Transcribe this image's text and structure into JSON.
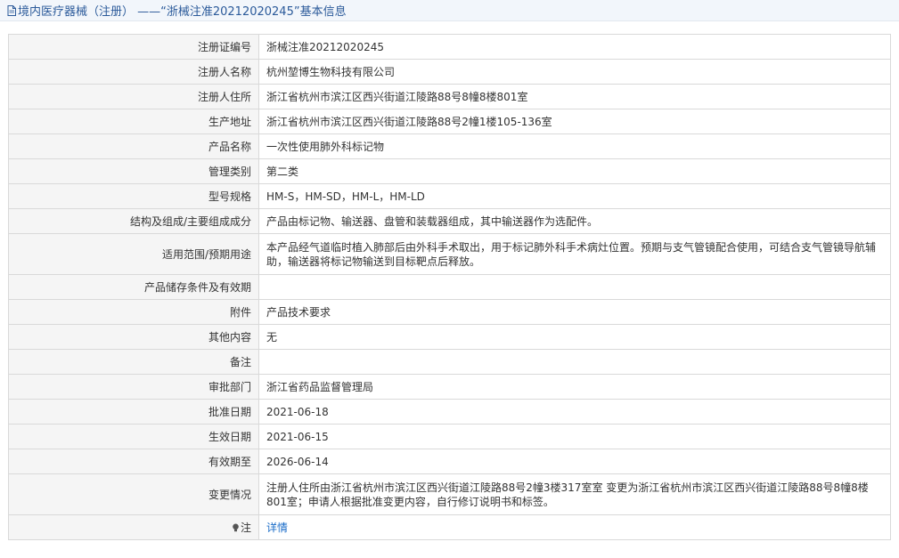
{
  "page": {
    "title": "境内医疗器械（注册） ——“浙械注准20212020245”基本信息"
  },
  "rows": [
    {
      "label": "注册证编号",
      "value": "浙械注准20212020245"
    },
    {
      "label": "注册人名称",
      "value": "杭州堃博生物科技有限公司"
    },
    {
      "label": "注册人住所",
      "value": "浙江省杭州市滨江区西兴街道江陵路88号8幢8楼801室"
    },
    {
      "label": "生产地址",
      "value": "浙江省杭州市滨江区西兴街道江陵路88号2幢1楼105-136室"
    },
    {
      "label": "产品名称",
      "value": "一次性使用肺外科标记物"
    },
    {
      "label": "管理类别",
      "value": "第二类"
    },
    {
      "label": "型号规格",
      "value": "HM-S，HM-SD，HM-L，HM-LD"
    },
    {
      "label": "结构及组成/主要组成成分",
      "value": "产品由标记物、输送器、盘管和装载器组成，其中输送器作为选配件。"
    },
    {
      "label": "适用范围/预期用途",
      "value": "本产品经气道临时植入肺部后由外科手术取出，用于标记肺外科手术病灶位置。预期与支气管镜配合使用，可结合支气管镜导航辅助，输送器将标记物输送到目标靶点后释放。"
    },
    {
      "label": "产品储存条件及有效期",
      "value": ""
    },
    {
      "label": "附件",
      "value": "产品技术要求"
    },
    {
      "label": "其他内容",
      "value": "无"
    },
    {
      "label": "备注",
      "value": ""
    },
    {
      "label": "审批部门",
      "value": "浙江省药品监督管理局"
    },
    {
      "label": "批准日期",
      "value": "2021-06-18"
    },
    {
      "label": "生效日期",
      "value": "2021-06-15"
    },
    {
      "label": "有效期至",
      "value": "2026-06-14"
    },
    {
      "label": "变更情况",
      "value": "注册人住所由浙江省杭州市滨江区西兴街道江陵路88号2幢3楼317室室 变更为浙江省杭州市滨江区西兴街道江陵路88号8幢8楼801室；申请人根据批准变更内容，自行修订说明书和标签。"
    }
  ],
  "note_row": {
    "label": "注",
    "link": "详情"
  },
  "colors": {
    "title": "#2b5a9a",
    "link": "#1a6cc8",
    "label_bg": "#f5f5f5",
    "border": "#d9d9d9"
  }
}
